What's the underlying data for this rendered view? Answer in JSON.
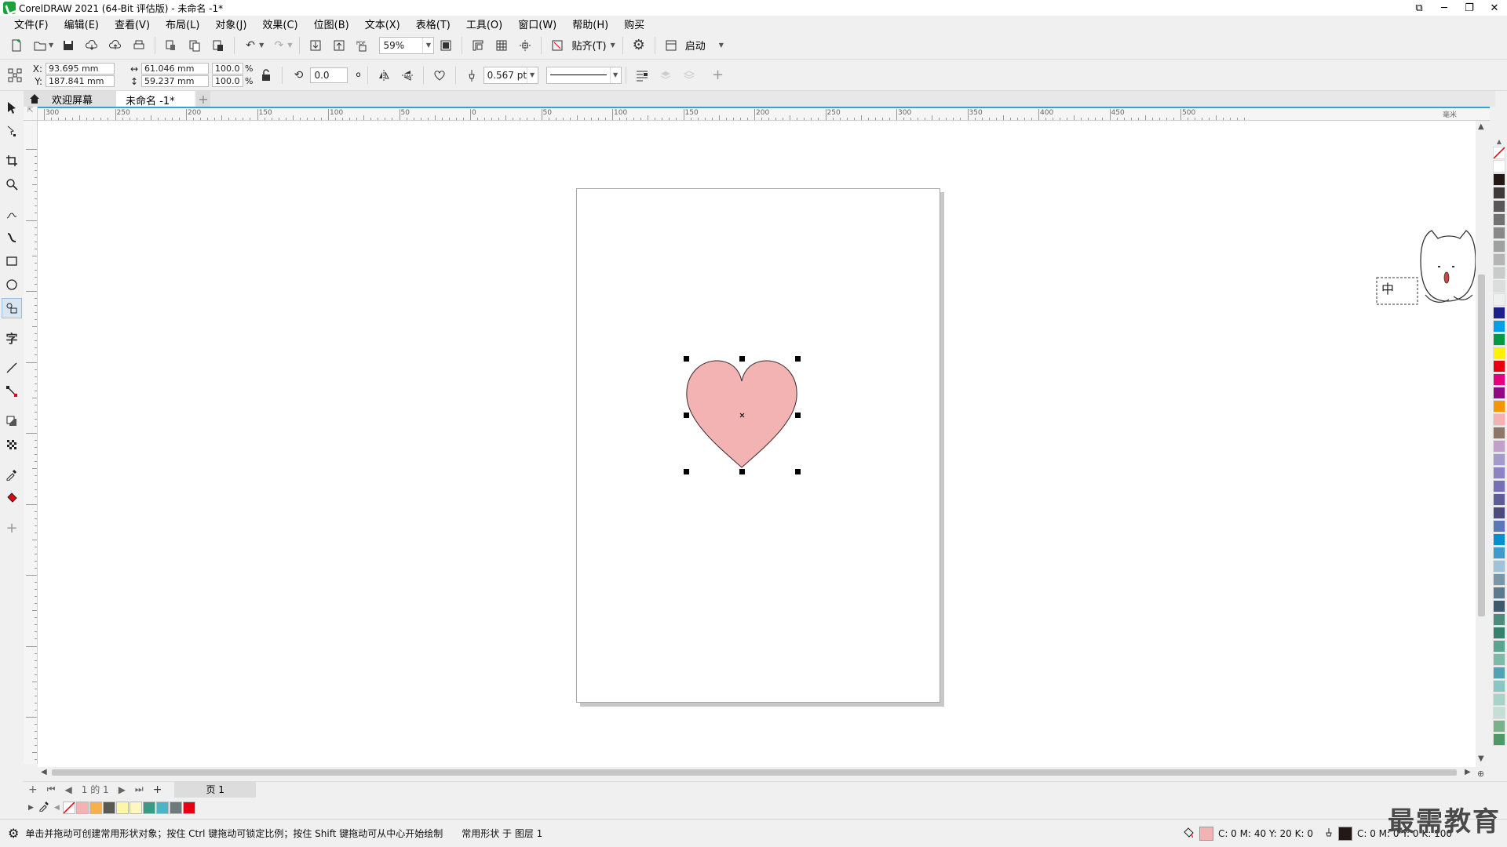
{
  "window": {
    "title": "CorelDRAW 2021 (64-Bit 评估版) - 未命名 -1*",
    "controls": [
      "⧉",
      "─",
      "❐",
      "✕"
    ]
  },
  "menu": [
    "文件(F)",
    "编辑(E)",
    "查看(V)",
    "布局(L)",
    "对象(J)",
    "效果(C)",
    "位图(B)",
    "文本(X)",
    "表格(T)",
    "工具(O)",
    "窗口(W)",
    "帮助(H)",
    "购买"
  ],
  "std_toolbar": {
    "zoom": "59%",
    "snap_label": "贴齐(T)",
    "launch_label": "启动"
  },
  "prop_bar": {
    "x_label": "X:",
    "x_value": "93.695 mm",
    "y_label": "Y:",
    "y_value": "187.841 mm",
    "w_value": "61.046 mm",
    "h_value": "59.237 mm",
    "scale_w": "100.0",
    "scale_h": "100.0",
    "pct": "%",
    "rotation": "0.0",
    "degree": "o",
    "outline_width": "0.567 pt"
  },
  "tabs": {
    "welcome": "欢迎屏幕",
    "document": "未命名 -1*",
    "add": "+"
  },
  "ruler": {
    "h_labels": [
      "300",
      "250",
      "200",
      "150",
      "100",
      "50",
      "0",
      "50",
      "100",
      "150",
      "200",
      "250",
      "300",
      "350",
      "400",
      "450",
      "500"
    ],
    "unit": "毫米"
  },
  "page_nav": {
    "page_of": "1 的 1",
    "page_tab": "页 1"
  },
  "status": {
    "hint": "单击并拖动可创建常用形状对象；按住 Ctrl 键拖动可锁定比例；按住 Shift 键拖动可从中心开始绘制",
    "object_info": "常用形状 于 图层 1",
    "fill_cmyk": "C: 0 M: 40 Y: 20 K: 0",
    "outline_cmyk": "C: 0 M: 0 Y: 0 K: 100"
  },
  "colors": {
    "heart_fill": "#f2b3b2",
    "heart_outline": "#3a2a2a",
    "ruler_accent": "#33a0d8",
    "outline_color": "#231815"
  },
  "palette_right": [
    "#ffffff",
    "#231815",
    "#3e3a39",
    "#595757",
    "#727171",
    "#898989",
    "#9fa0a0",
    "#b5b5b6",
    "#c9caca",
    "#dcdddd",
    "#efefef",
    "#1d2088",
    "#00a0e9",
    "#009944",
    "#fff100",
    "#e60012",
    "#e4007f",
    "#920783",
    "#f39800",
    "#f2b3b2",
    "#8f7767",
    "#c1a1c9",
    "#a59aca",
    "#8c83c0",
    "#7570b3",
    "#5f5d97",
    "#4b4b7c",
    "#5a78b7",
    "#0090d0",
    "#3e9bcb",
    "#9ec2d8",
    "#7997a9",
    "#5b7a8c",
    "#3c5a6b",
    "#4d8b7f",
    "#36816b",
    "#5aa58f",
    "#7fb9a7",
    "#50a3b4",
    "#8ac6c2",
    "#a7d3c9",
    "#c4e0d6",
    "#7ab189",
    "#4d9a67"
  ],
  "doc_palette": [
    "#f2b3b2",
    "#f7b04c",
    "#5a5a54",
    "#fdf6a6",
    "#fff7c2",
    "#3a9a84",
    "#4bb5c4",
    "#6e7b7d",
    "#e60012"
  ],
  "watermark": "最需教育",
  "ime": {
    "label": "中"
  }
}
